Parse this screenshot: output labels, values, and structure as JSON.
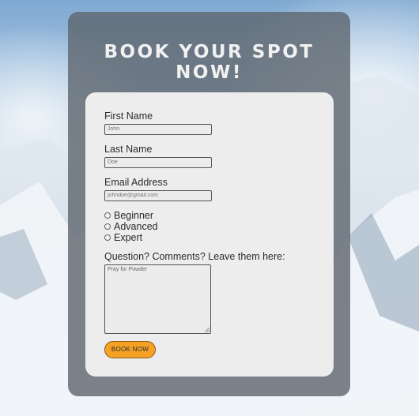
{
  "page": {
    "title": "BOOK YOUR SPOT NOW!"
  },
  "form": {
    "first_name": {
      "label": "First Name",
      "placeholder": "John"
    },
    "last_name": {
      "label": "Last Name",
      "placeholder": "Doe"
    },
    "email": {
      "label": "Email Address",
      "placeholder": "johndoe@gmail.com"
    },
    "levels": [
      "Beginner",
      "Advanced",
      "Expert"
    ],
    "comments": {
      "label": "Question? Comments? Leave them here:",
      "placeholder": "Pray for Powder"
    },
    "submit_label": "BOOK NOW"
  },
  "colors": {
    "button": "#f5a124",
    "card": "#5f6870",
    "form_bg": "#ededed"
  }
}
